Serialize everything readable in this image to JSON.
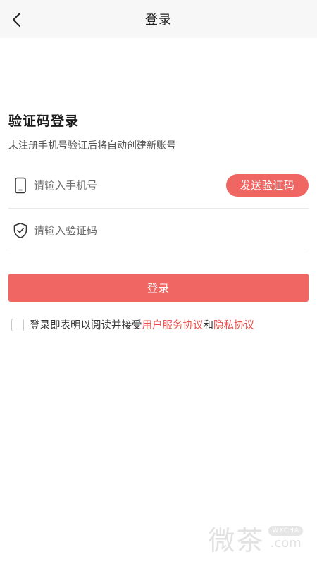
{
  "header": {
    "title": "登录",
    "back_icon": "chevron-left-icon"
  },
  "form": {
    "heading": "验证码登录",
    "subtitle": "未注册手机号验证后将自动创建新账号",
    "phone": {
      "placeholder": "请输入手机号",
      "value": "",
      "icon": "phone-icon"
    },
    "send_code_label": "发送验证码",
    "code": {
      "placeholder": "请输入验证码",
      "value": "",
      "icon": "shield-check-icon"
    },
    "login_label": "登录"
  },
  "agreement": {
    "checked": false,
    "prefix": "登录即表明以阅读并接受",
    "user_agreement": "用户服务协议",
    "and": "和",
    "privacy": "隐私协议"
  },
  "watermark": {
    "text": "微茶",
    "badge": "WXCHA",
    "domain": ".com"
  },
  "colors": {
    "accent": "#ef6663",
    "link": "#e9514e",
    "topbar_bg": "#f7f7f7"
  }
}
